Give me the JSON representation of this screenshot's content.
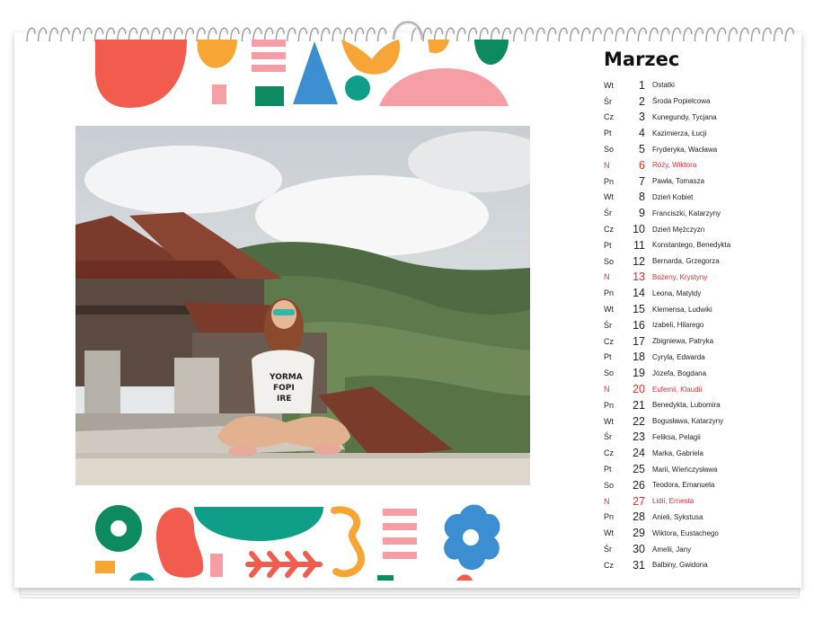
{
  "calendar": {
    "month": "Marzec",
    "days": [
      {
        "dow": "Wt",
        "num": "1",
        "names": "Ostatki",
        "sunday": false
      },
      {
        "dow": "Śr",
        "num": "2",
        "names": "Środa Popielcowa",
        "sunday": false
      },
      {
        "dow": "Cz",
        "num": "3",
        "names": "Kunegundy, Tycjana",
        "sunday": false
      },
      {
        "dow": "Pt",
        "num": "4",
        "names": "Kazimierza, Łucji",
        "sunday": false
      },
      {
        "dow": "So",
        "num": "5",
        "names": "Fryderyka, Wacława",
        "sunday": false
      },
      {
        "dow": "N",
        "num": "6",
        "names": "Róży, Wiktora",
        "sunday": true
      },
      {
        "dow": "Pn",
        "num": "7",
        "names": "Pawła, Tomasza",
        "sunday": false
      },
      {
        "dow": "Wt",
        "num": "8",
        "names": "Dzień Kobiet",
        "sunday": false
      },
      {
        "dow": "Śr",
        "num": "9",
        "names": "Franciszki, Katarzyny",
        "sunday": false
      },
      {
        "dow": "Cz",
        "num": "10",
        "names": "Dzień Mężczyzn",
        "sunday": false
      },
      {
        "dow": "Pt",
        "num": "11",
        "names": "Konstantego, Benedykta",
        "sunday": false
      },
      {
        "dow": "So",
        "num": "12",
        "names": "Bernarda, Grzegorza",
        "sunday": false
      },
      {
        "dow": "N",
        "num": "13",
        "names": "Bożeny, Krystyny",
        "sunday": true
      },
      {
        "dow": "Pn",
        "num": "14",
        "names": "Leona, Matyldy",
        "sunday": false
      },
      {
        "dow": "Wt",
        "num": "15",
        "names": "Klemensa, Ludwiki",
        "sunday": false
      },
      {
        "dow": "Śr",
        "num": "16",
        "names": "Izabeli, Hilarego",
        "sunday": false
      },
      {
        "dow": "Cz",
        "num": "17",
        "names": "Zbigniewa, Patryka",
        "sunday": false
      },
      {
        "dow": "Pt",
        "num": "18",
        "names": "Cyryla, Edwarda",
        "sunday": false
      },
      {
        "dow": "So",
        "num": "19",
        "names": "Józefa, Bogdana",
        "sunday": false
      },
      {
        "dow": "N",
        "num": "20",
        "names": "Eufemii, Klaudii",
        "sunday": true
      },
      {
        "dow": "Pn",
        "num": "21",
        "names": "Benedykta, Lubomira",
        "sunday": false
      },
      {
        "dow": "Wt",
        "num": "22",
        "names": "Bogusława, Katarzyny",
        "sunday": false
      },
      {
        "dow": "Śr",
        "num": "23",
        "names": "Feliksa, Pelagii",
        "sunday": false
      },
      {
        "dow": "Cz",
        "num": "24",
        "names": "Marka, Gabriela",
        "sunday": false
      },
      {
        "dow": "Pt",
        "num": "25",
        "names": "Marii, Wieńczysława",
        "sunday": false
      },
      {
        "dow": "So",
        "num": "26",
        "names": "Teodora, Emanuela",
        "sunday": false
      },
      {
        "dow": "N",
        "num": "27",
        "names": "Lidii, Ernesta",
        "sunday": true
      },
      {
        "dow": "Pn",
        "num": "28",
        "names": "Anieli, Sykstusa",
        "sunday": false
      },
      {
        "dow": "Wt",
        "num": "29",
        "names": "Wiktora, Eustachego",
        "sunday": false
      },
      {
        "dow": "Śr",
        "num": "30",
        "names": "Amelii, Jany",
        "sunday": false
      },
      {
        "dow": "Cz",
        "num": "31",
        "names": "Balbiny, Gwidona",
        "sunday": false
      }
    ]
  },
  "photo": {
    "shirt_text_lines": [
      "YORMA",
      "FOPI",
      "IRE"
    ]
  },
  "colors": {
    "red": "#f25c4f",
    "orange": "#f7a535",
    "pink": "#f59ea5",
    "blue": "#3b8ed0",
    "green": "#0e8a61",
    "teal": "#0f9e88",
    "sunday": "#e0312f"
  }
}
